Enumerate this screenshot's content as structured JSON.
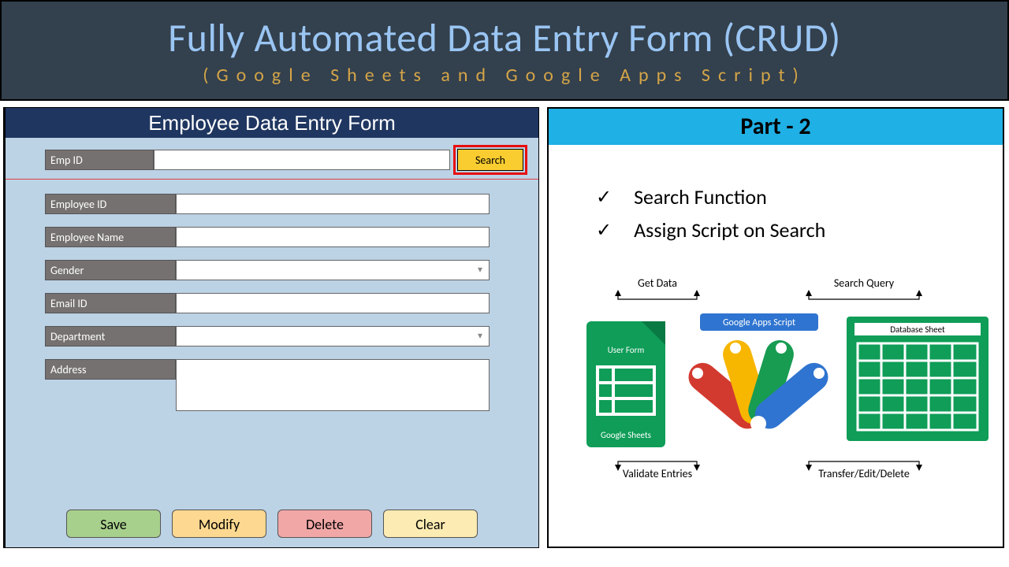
{
  "banner": {
    "title": "Fully Automated Data Entry Form (CRUD)",
    "subtitle": "(Google Sheets and Google Apps Script)"
  },
  "form": {
    "header": "Employee Data Entry Form",
    "search_label": "Emp ID",
    "search_button": "Search",
    "fields": [
      {
        "label": "Employee ID",
        "type": "text"
      },
      {
        "label": "Employee Name",
        "type": "text"
      },
      {
        "label": "Gender",
        "type": "dropdown"
      },
      {
        "label": "Email ID",
        "type": "text"
      },
      {
        "label": "Department",
        "type": "dropdown"
      },
      {
        "label": "Address",
        "type": "textarea"
      }
    ],
    "buttons": {
      "save": "Save",
      "modify": "Modify",
      "delete": "Delete",
      "clear": "Clear"
    }
  },
  "right": {
    "header": "Part - 2",
    "bullets": [
      "Search Function",
      "Assign Script on Search"
    ],
    "diagram": {
      "left_box_top": "User Form",
      "left_box_bottom": "Google Sheets",
      "center_top": "Google Apps Script",
      "right_box": "Database Sheet",
      "lbl_get": "Get Data",
      "lbl_validate": "Validate Entries",
      "lbl_search": "Search Query",
      "lbl_transfer": "Transfer/Edit/Delete"
    }
  }
}
